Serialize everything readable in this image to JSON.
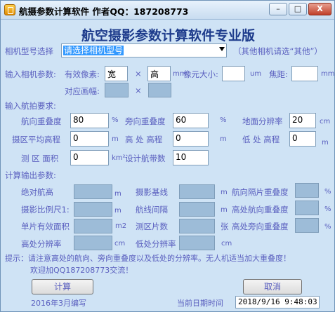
{
  "window": {
    "title": "航摄参数计算软件  作者QQ：187208773",
    "minimize_glyph": "–",
    "maximize_glyph": "□",
    "close_glyph": "X"
  },
  "heading": "航空摄影参数计算软件专业版",
  "camera": {
    "label": "相机型号选择",
    "selected": "请选择相机型号",
    "note": "（其他相机请选“其他”）"
  },
  "camera_params": {
    "section_label": "输入相机参数:",
    "pixels_label": "有效像素:",
    "width_value": "宽",
    "times": "×",
    "height_value": "高",
    "mm_unit": "mm",
    "pixel_size_label": "像元大小:",
    "um_unit": "um",
    "focal_label": "焦距:",
    "focal_unit": "mm",
    "diag_label": "对应画幅:"
  },
  "flight": {
    "section_label": "输入航拍要求:",
    "forward_overlap_label": "航向重叠度",
    "forward_overlap_value": "80",
    "side_overlap_label": "旁向重叠度",
    "side_overlap_value": "60",
    "percent": "%",
    "gsd_label": "地面分辨率",
    "gsd_value": "20",
    "cm_unit": "cm",
    "avg_elev_label": "摄区平均高程",
    "avg_elev_value": "0",
    "m_unit": "m",
    "high_elev_label": "高 处 高程",
    "high_elev_value": "0",
    "low_elev_label": "低 处 高程",
    "low_elev_value": "0",
    "area_label": "测 区 面积",
    "area_value": "0",
    "km2_unit": "km²",
    "strips_label": "设计航带数",
    "strips_value": "10"
  },
  "output": {
    "section_label": "计算输出参数:",
    "flight_height_label": "绝对航高",
    "baseline_label": "摄影基线",
    "strip_side_overlap_label": "航向隔片重叠度",
    "scale_label": "摄影比例尺1:",
    "line_spacing_label": "航线间隔",
    "high_forward_overlap_label": "高处航向重叠度",
    "single_area_label": "单片有效面积",
    "m2_unit": "m2",
    "photo_count_label": "测区片数",
    "sheet_unit": "张",
    "high_side_overlap_label": "高处旁向重叠度",
    "high_gsd_label": "高处分辨率",
    "low_gsd_label": "低处分辨率",
    "cm_unit": "cm",
    "m_unit": "m",
    "percent": "%"
  },
  "tips": {
    "line1": "提示：请注意高处的航向、旁向重叠度以及低处的分辨率。无人机适当加大重叠度！",
    "line2": "欢迎加QQ187208773交流！"
  },
  "buttons": {
    "calculate": "计算",
    "cancel": "取消"
  },
  "footer": {
    "edited": "2016年3月编写",
    "date_label": "当前日期时间",
    "datetime": "2018/9/16  9:48:03"
  }
}
